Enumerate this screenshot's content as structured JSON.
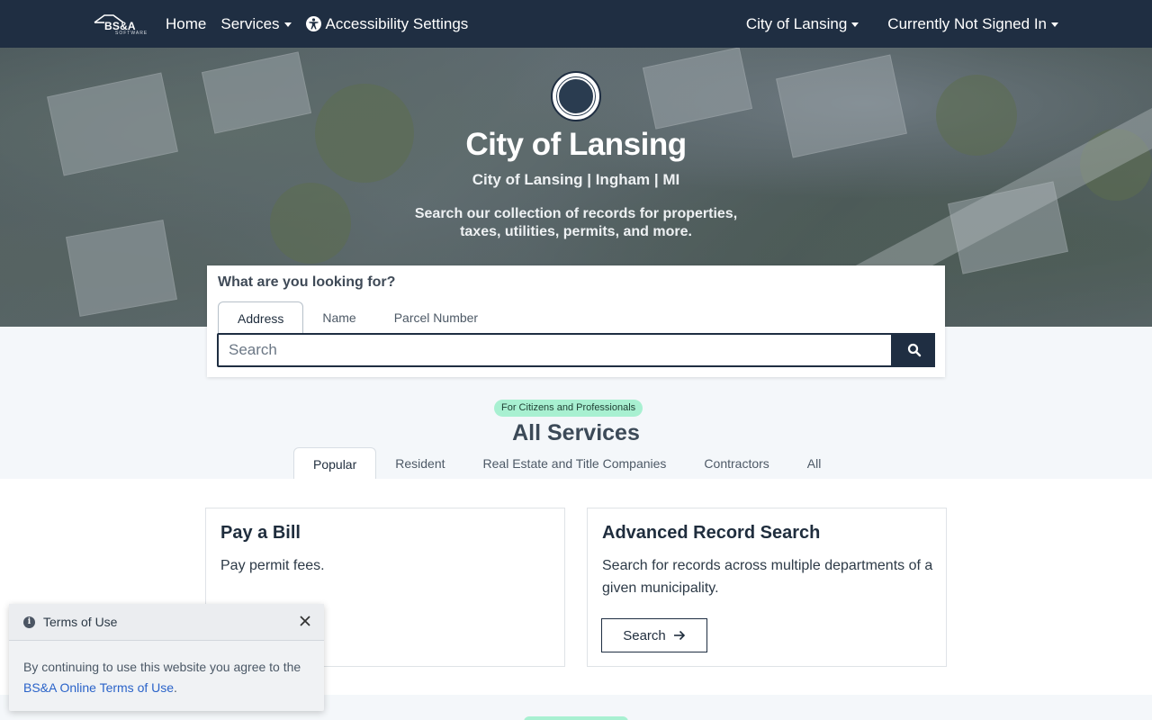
{
  "nav": {
    "brand": "BS&A",
    "brand_sub": "SOFTWARE",
    "home": "Home",
    "services": "Services",
    "accessibility": "Accessibility Settings",
    "municipality": "City of Lansing",
    "account": "Currently Not Signed In"
  },
  "hero": {
    "title": "City of Lansing",
    "subtitle": "City of Lansing | Ingham | MI",
    "description": "Search our collection of records for properties, taxes, utilities, permits, and more."
  },
  "search": {
    "label": "What are you looking for?",
    "tabs": [
      "Address",
      "Name",
      "Parcel Number"
    ],
    "active_tab": "Address",
    "placeholder": "Search",
    "value": ""
  },
  "services": {
    "badge": "For Citizens and Professionals",
    "title": "All Services",
    "tabs": [
      "Popular",
      "Resident",
      "Real Estate and Title Companies",
      "Contractors",
      "All"
    ],
    "active_tab": "Popular",
    "cards": [
      {
        "title": "Pay a Bill",
        "description": "Pay permit fees."
      },
      {
        "title": "Advanced Record Search",
        "description": "Search for records across multiple departments of a given municipality.",
        "button": "Search"
      }
    ]
  },
  "terms": {
    "title": "Terms of Use",
    "close": "X",
    "body_prefix": "By continuing to use this website you agree to the ",
    "link": "BS&A Online Terms of Use",
    "body_suffix": "."
  },
  "colors": {
    "navbar": "#1f2e42",
    "badge": "#a8f0d1",
    "link": "#2a63c9"
  },
  "icons": [
    "search-icon",
    "accessibility-icon",
    "info-icon",
    "arrow-right-icon",
    "caret-down-icon"
  ]
}
